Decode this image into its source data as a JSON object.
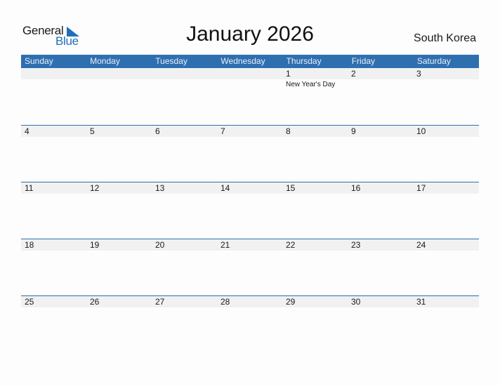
{
  "logo": {
    "part1": "General",
    "part2": "Blue"
  },
  "title": "January 2026",
  "country": "South Korea",
  "colors": {
    "header_bg": "#2e6fb0",
    "accent": "#1f6fb8",
    "strip_bg": "#f1f1f1"
  },
  "weekdays": [
    "Sunday",
    "Monday",
    "Tuesday",
    "Wednesday",
    "Thursday",
    "Friday",
    "Saturday"
  ],
  "weeks": [
    [
      {
        "day": ""
      },
      {
        "day": ""
      },
      {
        "day": ""
      },
      {
        "day": ""
      },
      {
        "day": "1",
        "holiday": "New Year's Day"
      },
      {
        "day": "2"
      },
      {
        "day": "3"
      }
    ],
    [
      {
        "day": "4"
      },
      {
        "day": "5"
      },
      {
        "day": "6"
      },
      {
        "day": "7"
      },
      {
        "day": "8"
      },
      {
        "day": "9"
      },
      {
        "day": "10"
      }
    ],
    [
      {
        "day": "11"
      },
      {
        "day": "12"
      },
      {
        "day": "13"
      },
      {
        "day": "14"
      },
      {
        "day": "15"
      },
      {
        "day": "16"
      },
      {
        "day": "17"
      }
    ],
    [
      {
        "day": "18"
      },
      {
        "day": "19"
      },
      {
        "day": "20"
      },
      {
        "day": "21"
      },
      {
        "day": "22"
      },
      {
        "day": "23"
      },
      {
        "day": "24"
      }
    ],
    [
      {
        "day": "25"
      },
      {
        "day": "26"
      },
      {
        "day": "27"
      },
      {
        "day": "28"
      },
      {
        "day": "29"
      },
      {
        "day": "30"
      },
      {
        "day": "31"
      }
    ]
  ]
}
